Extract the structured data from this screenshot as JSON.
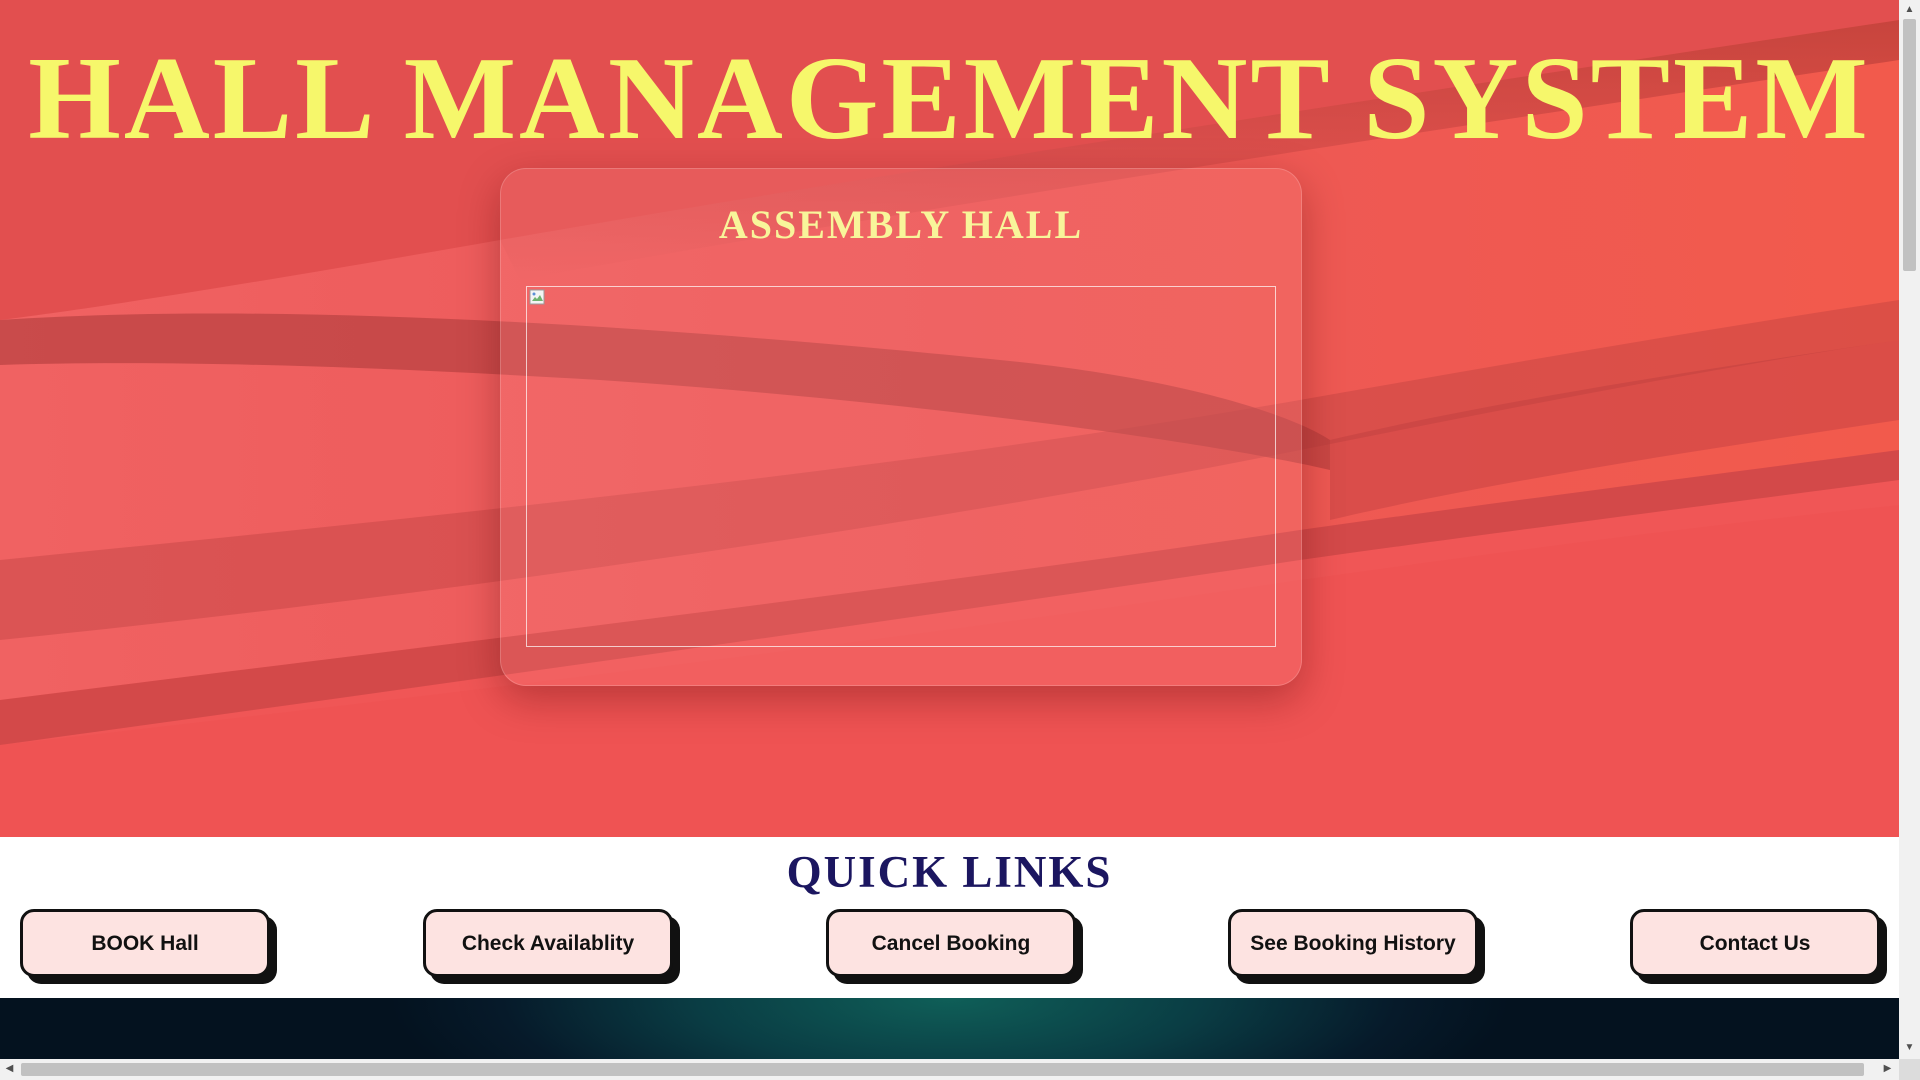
{
  "header": {
    "title": "HALL MANAGEMENT SYSTEM"
  },
  "hall_card": {
    "title": "ASSEMBLY HALL",
    "image_icon": "broken-image-icon"
  },
  "quick_links": {
    "title": "QUICK LINKS",
    "buttons": [
      {
        "label": "BOOK Hall"
      },
      {
        "label": "Check Availablity"
      },
      {
        "label": "Cancel Booking"
      },
      {
        "label": "See Booking History"
      },
      {
        "label": "Contact Us"
      }
    ]
  },
  "colors": {
    "hero_background": "#ee5353",
    "title_yellow": "#f6f76b",
    "quick_links_navy": "#1b1660",
    "button_fill": "#fde3e1",
    "footer_teal": "#0f5f58"
  }
}
